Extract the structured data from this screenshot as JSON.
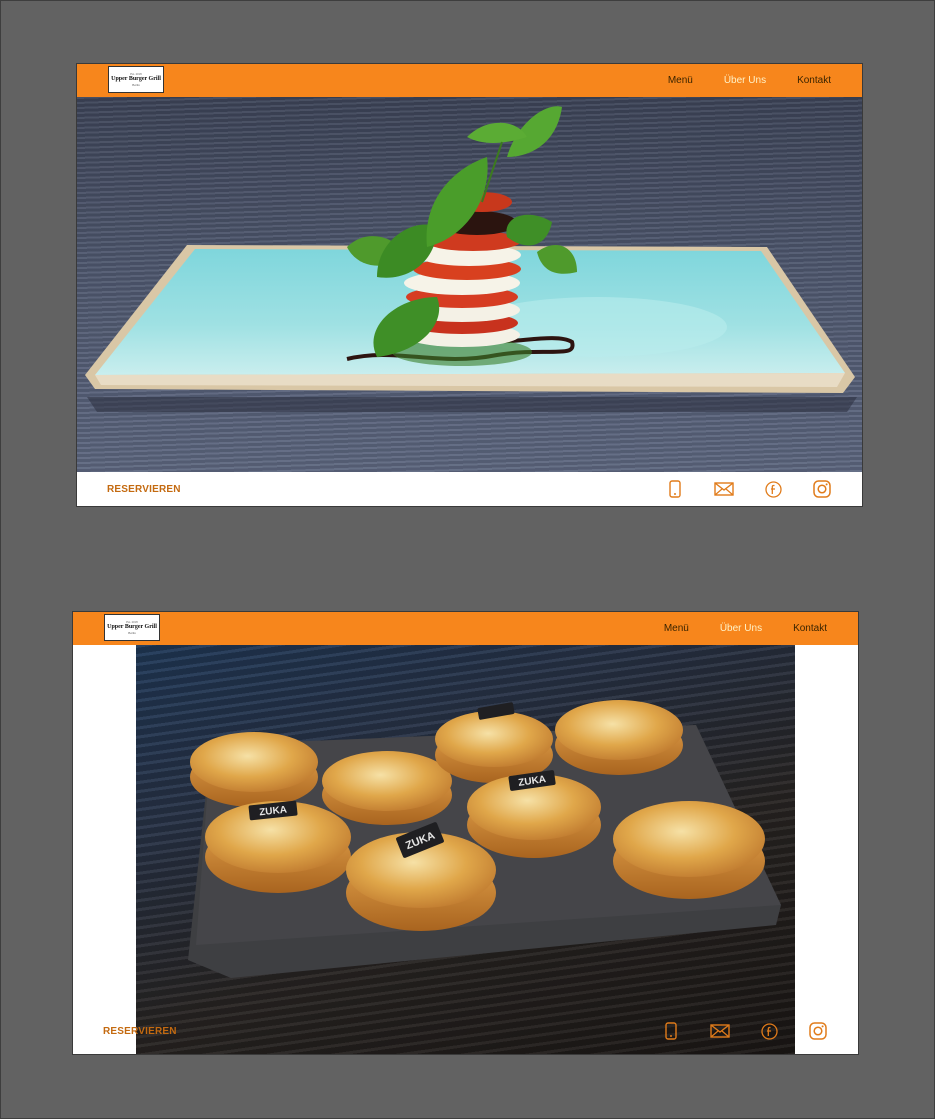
{
  "screens": [
    {
      "logo": {
        "tagline_top": "Est. 2018",
        "brand": "Upper Burger Grill",
        "tagline_bottom": "Berlin"
      },
      "nav": [
        {
          "label": "Menü"
        },
        {
          "label": "Über Uns"
        },
        {
          "label": "Kontakt"
        }
      ],
      "active_nav": "Über Uns",
      "hero": "caprese salad tower on turquoise plate",
      "reserve_label": "RESERVIEREN",
      "icons": [
        "phone-icon",
        "mail-icon",
        "facebook-icon",
        "instagram-icon"
      ]
    },
    {
      "logo": {
        "tagline_top": "Est. 2018",
        "brand": "Upper Burger Grill",
        "tagline_bottom": "Berlin"
      },
      "nav": [
        {
          "label": "Menü"
        },
        {
          "label": "Über Uns"
        },
        {
          "label": "Kontakt"
        }
      ],
      "active_nav": "Über Uns",
      "hero": "meringue tarts on slate board",
      "tart_tag": "ZUKA",
      "reserve_label": "RESERVIEREN",
      "icons": [
        "phone-icon",
        "mail-icon",
        "facebook-icon",
        "instagram-icon"
      ]
    }
  ],
  "colors": {
    "accent": "#f7861c",
    "reserve": "#c46a10",
    "background": "#626262",
    "active_nav": "#fff2c7"
  }
}
